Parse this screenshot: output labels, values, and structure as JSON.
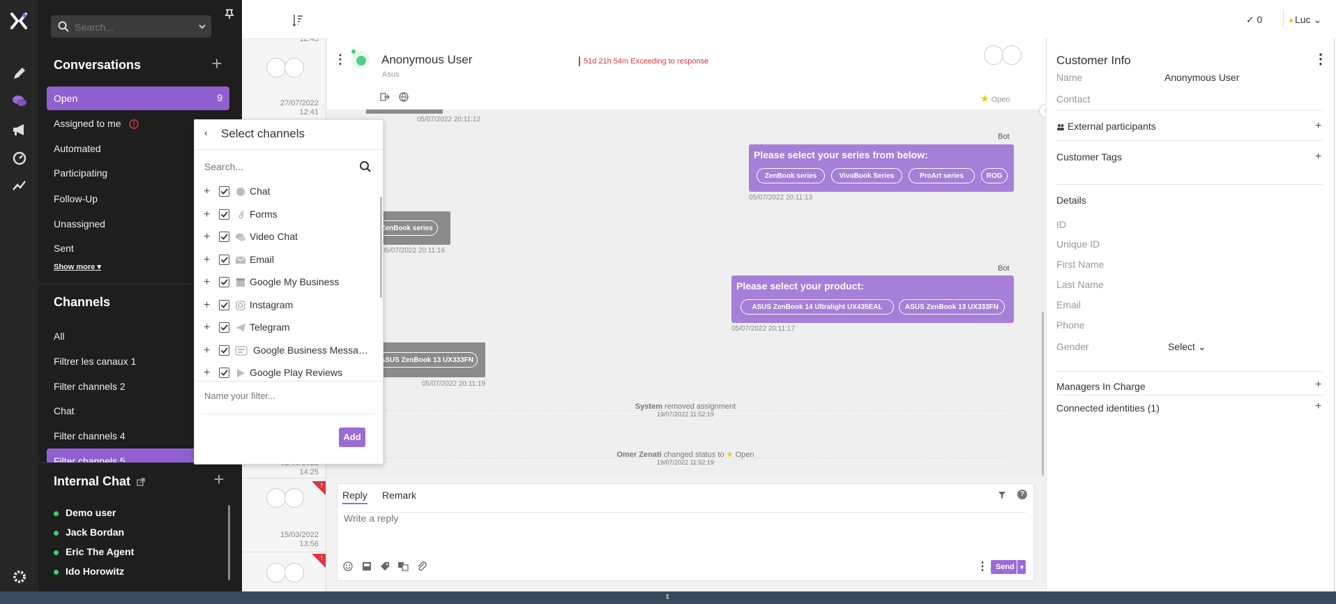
{
  "left_panel": {
    "search_placeholder": "Search...",
    "conversations": {
      "title": "Conversations",
      "items": [
        {
          "label": "Open",
          "count": "9"
        },
        {
          "label": "Assigned to me"
        },
        {
          "label": "Automated"
        },
        {
          "label": "Participating"
        },
        {
          "label": "Follow-Up"
        },
        {
          "label": "Unassigned"
        },
        {
          "label": "Sent"
        }
      ],
      "show_more": "Show more"
    },
    "channels": {
      "title": "Channels",
      "items": [
        "All",
        "Filtrer les canaux 1",
        "Filter channels 2",
        "Chat",
        "Filter channels 4",
        "Filter channels 5"
      ]
    },
    "internal_chat": {
      "title": "Internal Chat",
      "users": [
        "Demo user",
        "Jack Bordan",
        "Eric The Agent",
        "Ido Horowitz"
      ]
    }
  },
  "list_column": {
    "timestamps": [
      {
        "date": "",
        "time": "12:45"
      },
      {
        "date": "27/07/2022",
        "time": "12:41"
      },
      {
        "date": "01/03/2022",
        "time": "14:25"
      },
      {
        "date": "15/03/2022",
        "time": "13:56"
      }
    ]
  },
  "topbar": {
    "check_count": "0",
    "user": "Luc"
  },
  "conversation": {
    "name": "Anonymous User",
    "subtitle": "Asus",
    "sla": "51d 21h 54m Exceeding to response",
    "status": "Open"
  },
  "chat": {
    "first_time": "05/07/2022 20:11:12",
    "messages": [
      {
        "sender": "Bot",
        "text": "Please select your series from below:",
        "options": [
          "ZenBook series",
          "VivoBook Series",
          "ProArt series",
          "ROG"
        ],
        "time": "05/07/2022 20:11:13"
      },
      {
        "user_option": "ZenBook series",
        "time": "05/07/2022 20:11:16"
      },
      {
        "sender": "Bot",
        "text": "Please select your product:",
        "options": [
          "ASUS ZenBook 14 Ultralight UX435EAL",
          "ASUS ZenBook 13 UX333FN"
        ],
        "time": "05/07/2022 20:11:17"
      },
      {
        "user_option": "ASUS ZenBook 13 UX333FN",
        "time": "05/07/2022 20:11:19"
      }
    ],
    "system_events": [
      {
        "actor": "System",
        "action": "removed assignment",
        "time": "19/07/2022 11:52:19"
      },
      {
        "actor": "Omer Zenati",
        "action": "changed status to",
        "status": "Open",
        "time": "19/07/2022 11:52:19"
      }
    ]
  },
  "reply": {
    "tabs": [
      "Reply",
      "Remark"
    ],
    "placeholder": "Write a reply",
    "send_label": "Send"
  },
  "customer_info": {
    "title": "Customer Info",
    "name_label": "Name",
    "name_value": "Anonymous User",
    "contact_label": "Contact",
    "external_participants": "External participants",
    "customer_tags": "Customer Tags",
    "details_title": "Details",
    "fields": [
      "ID",
      "Unique ID",
      "First Name",
      "Last Name",
      "Email",
      "Phone"
    ],
    "gender_label": "Gender",
    "gender_value": "Select",
    "managers": "Managers In Charge",
    "connected_identities": "Connected identities (1)"
  },
  "select_channels": {
    "title": "Select channels",
    "search_placeholder": "Search...",
    "channels": [
      "Chat",
      "Forms",
      "Video Chat",
      "Email",
      "Google My Business",
      "Instagram",
      "Telegram",
      "Google Business Messages",
      "Google Play Reviews"
    ],
    "filter_placeholder": "Name your filter...",
    "add_label": "Add"
  },
  "colors": {
    "accent": "#9b6bd6",
    "sidebar": "#1e1e1e",
    "danger": "#d9363e"
  }
}
